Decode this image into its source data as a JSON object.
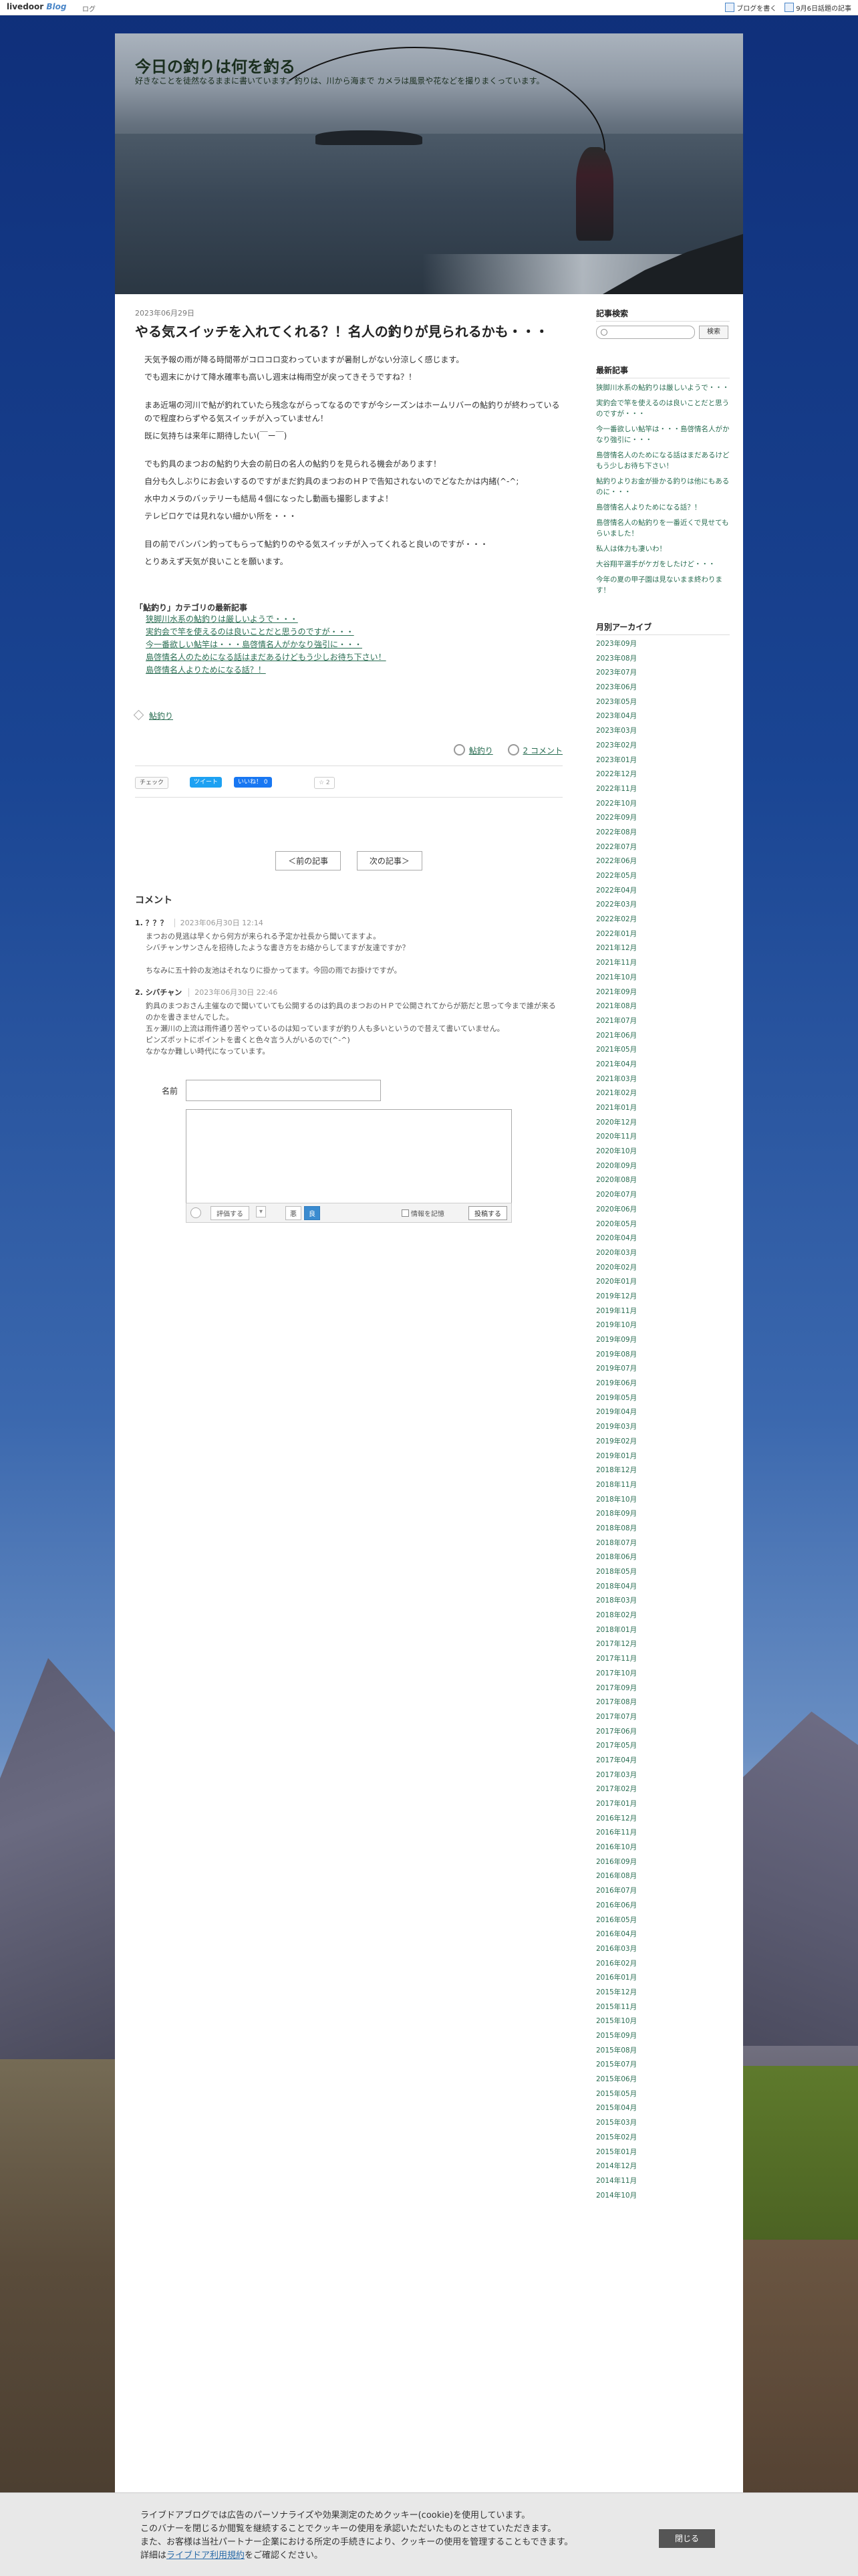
{
  "topbar": {
    "logo_main": "livedoor",
    "logo_sub": "Blog",
    "logout": "ログ",
    "write_blog": "ブログを書く",
    "hot_topics": "9月6日話題の記事"
  },
  "site": {
    "title": "今日の釣りは何を釣る",
    "description": "好きなことを徒然なるままに書いています。釣りは、川から海まで カメラは風景や花などを撮りまくっています。"
  },
  "article": {
    "date": "2023年06月29日",
    "title": "やる気スイッチを入れてくれる？！名人の釣りが見られるかも・・・",
    "paragraphs": [
      "天気予報の雨が降る時間帯がコロコロ変わっていますが暑耐しがない分涼しく感じます。",
      "でも週末にかけて降水確率も高いし週末は梅雨空が戻ってきそうですね？！",
      "",
      "まあ近場の河川で鮎が釣れていたら残念ながらってなるのですが今シーズンはホームリバーの鮎釣りが終わっているので程度わらずやる気スイッチが入っていません！",
      "既に気持ちは来年に期待したい(￣ー￣)",
      "",
      "でも釣具のまつおの鮎釣り大会の前日の名人の鮎釣りを見られる機会があります！",
      "自分も久しぶりにお会いするのですがまだ釣具のまつおのＨＰで告知されないのでどなたかは内緒(^-^;",
      "水中カメラのバッテリーも結局４個になったし動画も撮影しますよ！",
      "テレビロケでは見れない細かい所を・・・",
      "",
      "目の前でバンバン釣ってもらって鮎釣りのやる気スイッチが入ってくれると良いのですが・・・",
      "とりあえず天気が良いことを願います。"
    ]
  },
  "latest": {
    "heading": "「鮎釣り」カテゴリの最新記事",
    "items": [
      "狭脚川水系の鮎釣りは厳しいようで・・・",
      "実釣会で竿を使えるのは良いことだと思うのですが・・・",
      "今一番欲しい鮎竿は・・・島啓情名人がかなり強引に・・・",
      "島啓情名人のためになる話はまだあるけどもう少しお待ち下さい！",
      "島啓情名人よりためになる話？！"
    ]
  },
  "tags": {
    "category": "鮎釣り"
  },
  "meta": {
    "category": "鮎釣り",
    "comments": "2 コメント"
  },
  "share": {
    "check": "チェック",
    "tweet": "ツイート",
    "like": "いいね！ 0",
    "star": "☆ 2"
  },
  "nav": {
    "prev": "＜前の記事",
    "next": "次の記事＞"
  },
  "comments": {
    "heading": "コメント",
    "list": [
      {
        "author": "1. ？？？",
        "date": "2023年06月30日 12:14",
        "text": "まつおの見逃は早くから何方が来られる予定か社長から聞いてますよ。\nシバチャンサンさんを招待したような書き方をお絡からしてますが友達ですか？\n\nちなみに五十鈴の友池はそれなりに掛かってます。今回の雨でお掛けですが。"
      },
      {
        "author": "2. シバチャン",
        "date": "2023年06月30日 22:46",
        "text": "釣具のまつおさん主催なので聞いていても公開するのは釣具のまつおのＨＰで公開されてからが筋だと思って今まで誰が来るのかを書きませんでした。\n五ヶ瀬川の上流は雨件通り苦やっているのは知っていますが釣り人も多いというので昔えて書いていません。\nピンズポットにポイントを書くと色々言う人がいるので(^-^)\nなかなか難しい時代になっています。"
      }
    ]
  },
  "form": {
    "name_label": "名前",
    "rate": "評価する",
    "bad": "悪",
    "good": "良",
    "remember": "情報を記憶",
    "submit": "投稿する"
  },
  "sidebar": {
    "search_heading": "記事検索",
    "search_button": "検索",
    "recent_heading": "最新記事",
    "recent": [
      "狭脚川水系の鮎釣りは厳しいようで・・・",
      "実釣会で竿を使えるのは良いことだと思うのですが・・・",
      "今一番欲しい鮎竿は・・・島啓情名人がかなり強引に・・・",
      "島啓情名人のためになる話はまだあるけどもう少しお待ち下さい！",
      "鮎釣りよりお金が掛かる釣りは他にもあるのに・・・",
      "島啓情名人よりためになる話？！",
      "島啓情名人の鮎釣りを一番近くで見せてもらいました！",
      "私人は体力も凄いわ！",
      "大谷翔平選手がケガをしたけど・・・",
      "今年の夏の甲子園は見ないまま終わります！"
    ],
    "archive_heading": "月別アーカイブ",
    "archive": [
      "2023年09月",
      "2023年08月",
      "2023年07月",
      "2023年06月",
      "2023年05月",
      "2023年04月",
      "2023年03月",
      "2023年02月",
      "2023年01月",
      "2022年12月",
      "2022年11月",
      "2022年10月",
      "2022年09月",
      "2022年08月",
      "2022年07月",
      "2022年06月",
      "2022年05月",
      "2022年04月",
      "2022年03月",
      "2022年02月",
      "2022年01月",
      "2021年12月",
      "2021年11月",
      "2021年10月",
      "2021年09月",
      "2021年08月",
      "2021年07月",
      "2021年06月",
      "2021年05月",
      "2021年04月",
      "2021年03月",
      "2021年02月",
      "2021年01月",
      "2020年12月",
      "2020年11月",
      "2020年10月",
      "2020年09月",
      "2020年08月",
      "2020年07月",
      "2020年06月",
      "2020年05月",
      "2020年04月",
      "2020年03月",
      "2020年02月",
      "2020年01月",
      "2019年12月",
      "2019年11月",
      "2019年10月",
      "2019年09月",
      "2019年08月",
      "2019年07月",
      "2019年06月",
      "2019年05月",
      "2019年04月",
      "2019年03月",
      "2019年02月",
      "2019年01月",
      "2018年12月",
      "2018年11月",
      "2018年10月",
      "2018年09月",
      "2018年08月",
      "2018年07月",
      "2018年06月",
      "2018年05月",
      "2018年04月",
      "2018年03月",
      "2018年02月",
      "2018年01月",
      "2017年12月",
      "2017年11月",
      "2017年10月",
      "2017年09月",
      "2017年08月",
      "2017年07月",
      "2017年06月",
      "2017年05月",
      "2017年04月",
      "2017年03月",
      "2017年02月",
      "2017年01月",
      "2016年12月",
      "2016年11月",
      "2016年10月",
      "2016年09月",
      "2016年08月",
      "2016年07月",
      "2016年06月",
      "2016年05月",
      "2016年04月",
      "2016年03月",
      "2016年02月",
      "2016年01月",
      "2015年12月",
      "2015年11月",
      "2015年10月",
      "2015年09月",
      "2015年08月",
      "2015年07月",
      "2015年06月",
      "2015年05月",
      "2015年04月",
      "2015年03月",
      "2015年02月",
      "2015年01月",
      "2014年12月",
      "2014年11月",
      "2014年10月"
    ]
  },
  "cookie": {
    "line1": "ライブドアブログでは広告のパーソナライズや効果測定のためクッキー(cookie)を使用しています。",
    "line2": "このバナーを閉じるか閲覧を継続することでクッキーの使用を承認いただいたものとさせていただきます。",
    "line3": "また、お客様は当社パートナー企業における所定の手続きにより、クッキーの使用を管理することもできます。",
    "line4_pre": "詳細は",
    "line4_link": "ライブドア利用規約",
    "line4_post": "をご確認ください。",
    "close": "閉じる"
  }
}
